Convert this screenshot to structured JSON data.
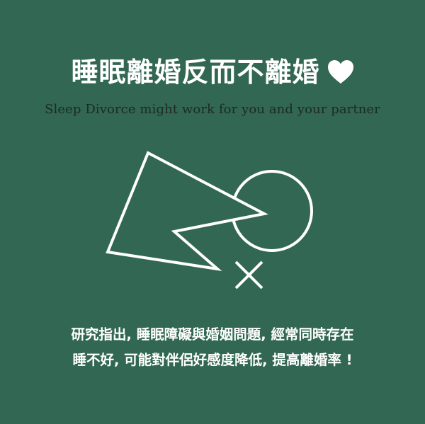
{
  "card": {
    "title": "睡眠離婚反而不離婚",
    "heart_icon": "heart-icon",
    "subtitle": "Sleep Divorce might work for you and your partner",
    "illustration_icons": [
      "triangle-shape",
      "circle-shape",
      "cross-icon"
    ],
    "body_lines": [
      "研究指出, 睡眠障礙與婚姻問題, 經常同時存在",
      "睡不好, 可能對伴侶好感度降低, 提高離婚率 !"
    ]
  },
  "colors": {
    "background": "#316753",
    "foreground": "#ffffff",
    "subtitle": "#1e2a24"
  }
}
